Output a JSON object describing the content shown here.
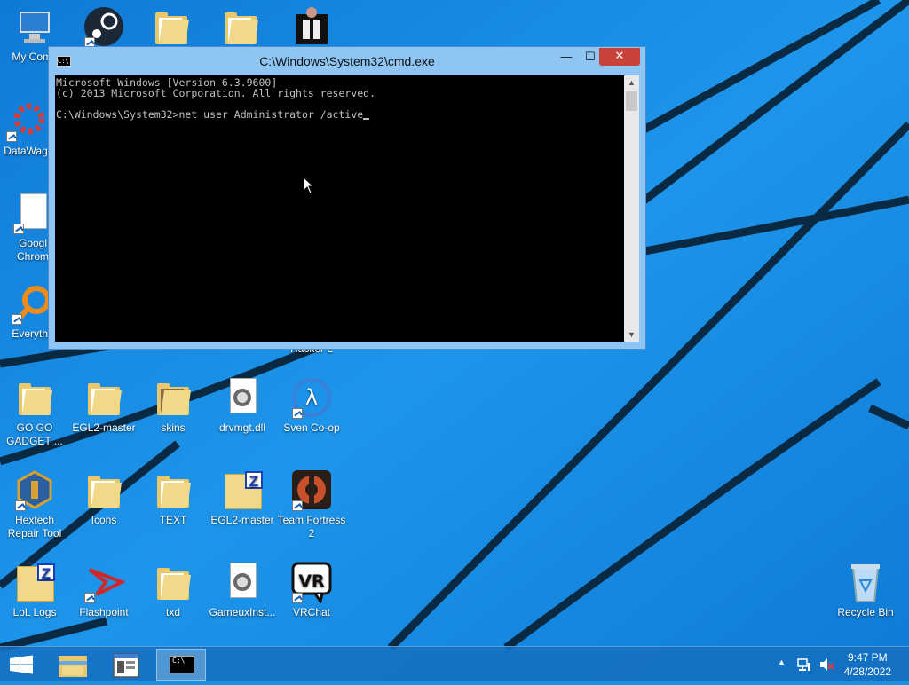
{
  "window": {
    "title": "C:\\Windows\\System32\\cmd.exe",
    "icon_text": "C:\\",
    "lines": [
      "Microsoft Windows [Version 6.3.9600]",
      "(c) 2013 Microsoft Corporation. All rights reserved.",
      "",
      "C:\\Windows\\System32>net user Administrator /active"
    ],
    "minimize": "—",
    "maximize": "☐",
    "close": "✕",
    "scroll_up": "▲",
    "scroll_down": "▼"
  },
  "desktop": {
    "icons": [
      {
        "label": "My Comp"
      },
      {
        "label": "DataWag"
      },
      {
        "label": "Googl Chrom"
      },
      {
        "label": "Everythi"
      },
      {
        "label": "GO GO GADGET ..."
      },
      {
        "label": "EGL2-master"
      },
      {
        "label": "skins"
      },
      {
        "label": "drvmgt.dll"
      },
      {
        "label": "Sven Co-op"
      },
      {
        "label": "Hextech Repair Tool"
      },
      {
        "label": "Icons"
      },
      {
        "label": "TEXT"
      },
      {
        "label": "EGL2-master"
      },
      {
        "label": "Team Fortress 2"
      },
      {
        "label": "LoL Logs"
      },
      {
        "label": "Flashpoint"
      },
      {
        "label": "txd"
      },
      {
        "label": "GameuxInst..."
      },
      {
        "label": "VRChat"
      },
      {
        "label": "Recycle Bin"
      },
      {
        "label": "Hacker L"
      }
    ],
    "badges": {
      "sven": "λ",
      "vr": "VR",
      "zip": "Z"
    }
  },
  "taskbar": {
    "time": "9:47 PM",
    "date": "4/28/2022",
    "cmd_icon_text": "C:\\",
    "tray_up": "▲"
  },
  "colors": {
    "accent": "#1a8fe0",
    "close": "#c7433a"
  }
}
